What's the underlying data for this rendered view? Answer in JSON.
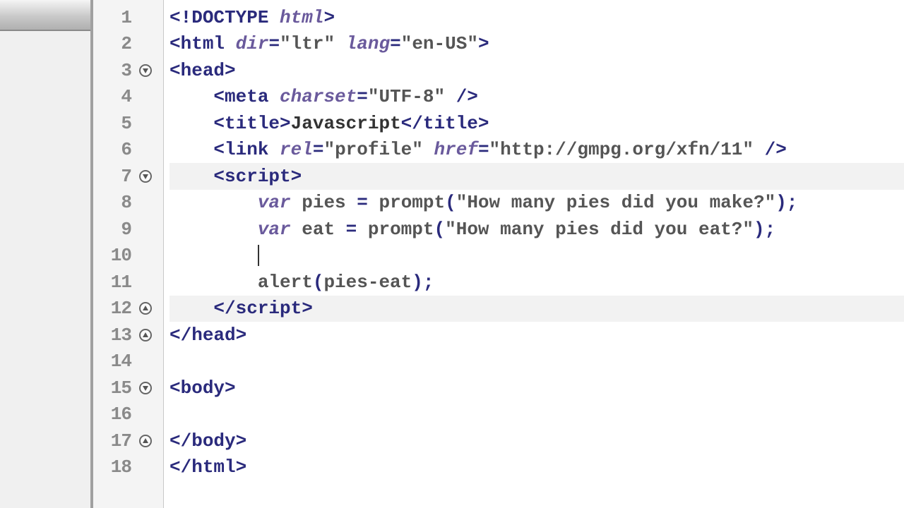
{
  "lines": [
    "1",
    "2",
    "3",
    "4",
    "5",
    "6",
    "7",
    "8",
    "9",
    "10",
    "11",
    "12",
    "13",
    "14",
    "15",
    "16",
    "17",
    "18"
  ],
  "fold": {
    "down": "▼",
    "up": "▲"
  },
  "code": {
    "l1": {
      "p1": "<!",
      "t": "DOCTYPE",
      "sp": " ",
      "a": "html",
      "p2": ">"
    },
    "l2": {
      "p1": "<",
      "t": "html",
      "sp1": " ",
      "a1": "dir",
      "eq1": "=",
      "s1": "\"ltr\"",
      "sp2": " ",
      "a2": "lang",
      "eq2": "=",
      "s2": "\"en-US\"",
      "p2": ">"
    },
    "l3": {
      "p1": "<",
      "t": "head",
      "p2": ">"
    },
    "l4": {
      "p1": "<",
      "t": "meta",
      "sp": " ",
      "a": "charset",
      "eq": "=",
      "s": "\"UTF-8\"",
      "p2": " />"
    },
    "l5": {
      "p1": "<",
      "t": "title",
      "p2": ">",
      "txt": "Javascript",
      "p3": "</",
      "t2": "title",
      "p4": ">"
    },
    "l6": {
      "p1": "<",
      "t": "link",
      "sp1": " ",
      "a1": "rel",
      "eq1": "=",
      "s1": "\"profile\"",
      "sp2": " ",
      "a2": "href",
      "eq2": "=",
      "s2": "\"http://gmpg.org/xfn/11\"",
      "p2": " />"
    },
    "l7": {
      "p1": "<",
      "t": "script",
      "p2": ">"
    },
    "l8": {
      "kw": "var",
      "sp1": " ",
      "id": "pies",
      "sp2": " ",
      "eq": "=",
      "sp3": " ",
      "fn": "prompt",
      "p1": "(",
      "s": "\"How many pies did you make?\"",
      "p2": ");"
    },
    "l9": {
      "kw": "var",
      "sp1": " ",
      "id": "eat",
      "sp2": " ",
      "eq": "=",
      "sp3": " ",
      "fn": "prompt",
      "p1": "(",
      "s": "\"How many pies did you eat?\"",
      "p2": ");"
    },
    "l11": {
      "fn": "alert",
      "p1": "(",
      "e": "pies-eat",
      "p2": ");"
    },
    "l12": {
      "p1": "</",
      "t": "script",
      "p2": ">"
    },
    "l13": {
      "p1": "</",
      "t": "head",
      "p2": ">"
    },
    "l15": {
      "p1": "<",
      "t": "body",
      "p2": ">"
    },
    "l17": {
      "p1": "</",
      "t": "body",
      "p2": ">"
    },
    "l18": {
      "p1": "</",
      "t": "html",
      "p2": ">"
    }
  }
}
